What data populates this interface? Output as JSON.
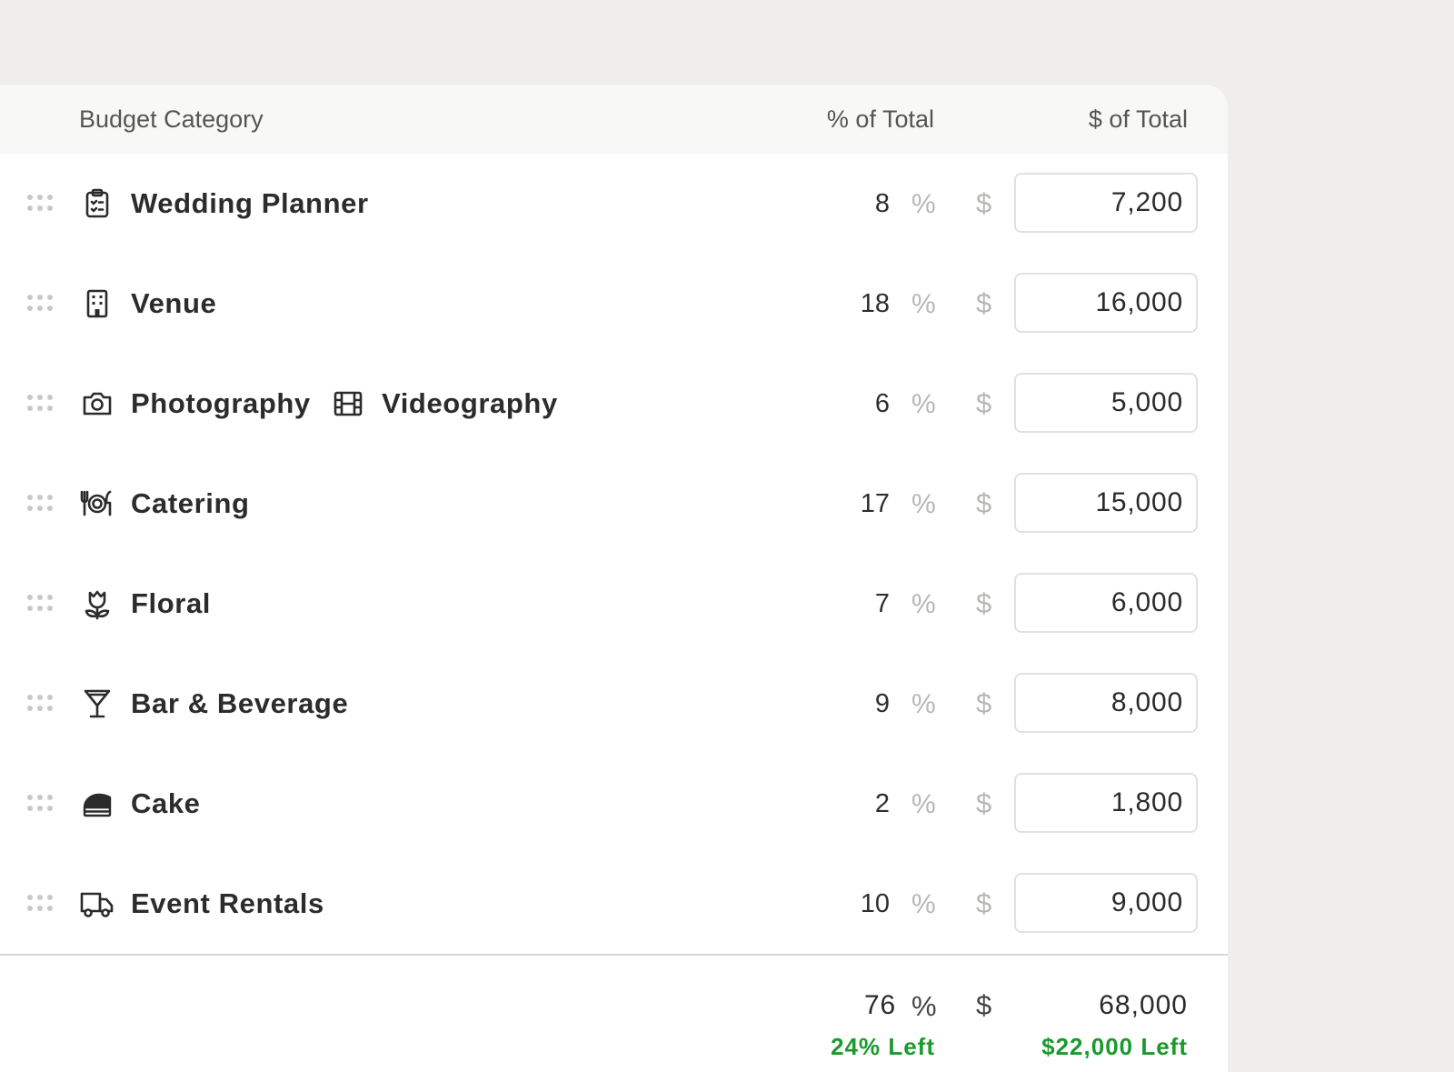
{
  "header": {
    "category": "Budget Category",
    "percent": "% of Total",
    "dollar": "$ of Total"
  },
  "symbols": {
    "percent": "%",
    "dollar": "$"
  },
  "rows": [
    {
      "label": "Wedding Planner",
      "icon": "clipboard-icon",
      "percent": "8",
      "amount": "7,200"
    },
    {
      "label": "Venue",
      "icon": "building-icon",
      "percent": "18",
      "amount": "16,000"
    },
    {
      "label": "Photography",
      "icon": "camera-icon",
      "label2": "Videography",
      "icon2": "film-icon",
      "percent": "6",
      "amount": "5,000"
    },
    {
      "label": "Catering",
      "icon": "dinner-plate-icon",
      "percent": "17",
      "amount": "15,000"
    },
    {
      "label": "Floral",
      "icon": "flower-icon",
      "percent": "7",
      "amount": "6,000"
    },
    {
      "label": "Bar & Beverage",
      "icon": "cocktail-glass-icon",
      "percent": "9",
      "amount": "8,000"
    },
    {
      "label": "Cake",
      "icon": "cake-icon",
      "percent": "2",
      "amount": "1,800"
    },
    {
      "label": "Event Rentals",
      "icon": "truck-icon",
      "percent": "10",
      "amount": "9,000"
    }
  ],
  "totals": {
    "percent": "76",
    "amount": "68,000",
    "percent_left": "24% Left",
    "amount_left": "$22,000 Left"
  },
  "colors": {
    "background": "#efeeec",
    "remaining": "#1a9a2d",
    "muted_symbol": "#b8b7b5"
  }
}
